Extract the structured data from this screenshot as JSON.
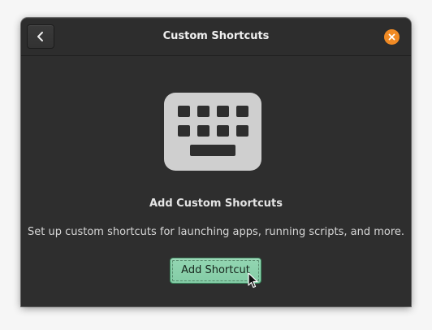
{
  "dialog": {
    "title": "Custom Shortcuts"
  },
  "header": {
    "back_icon": "chevron-left-icon",
    "close_icon": "close-icon",
    "close_color": "#f08a24"
  },
  "content": {
    "icon": "keyboard-icon",
    "heading": "Add Custom Shortcuts",
    "description": "Set up custom shortcuts for launching apps, running scripts, and more.",
    "add_button_label": "Add Shortcut",
    "accent_color": "#8ad1ab"
  }
}
